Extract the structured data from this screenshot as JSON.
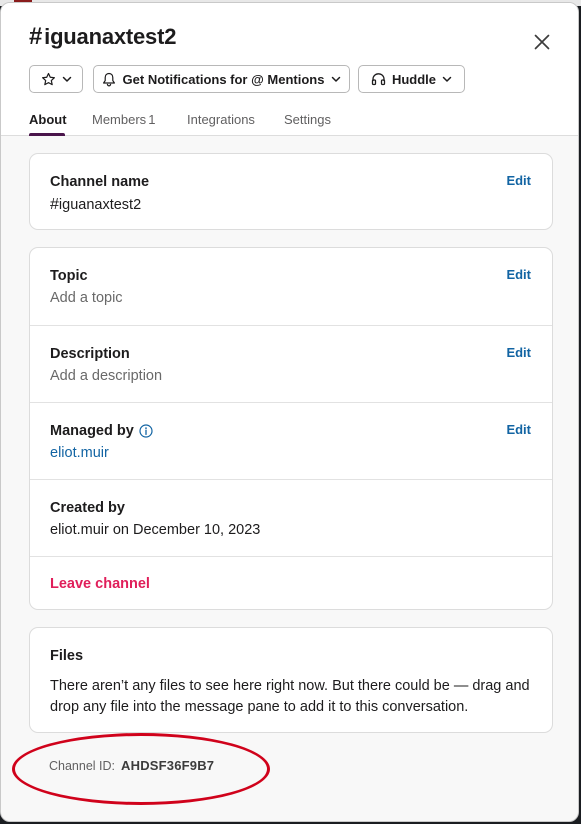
{
  "header": {
    "hash": "#",
    "channel_name": "iguanaxtest2",
    "notifications_label": "Get Notifications for @ Mentions",
    "huddle_label": "Huddle"
  },
  "tabs": [
    {
      "label": "About"
    },
    {
      "label": "Members",
      "count": "1"
    },
    {
      "label": "Integrations"
    },
    {
      "label": "Settings"
    }
  ],
  "channel_card": {
    "label": "Channel name",
    "hash": "#",
    "value": "iguanaxtest2",
    "edit": "Edit"
  },
  "details_card": {
    "topic": {
      "label": "Topic",
      "placeholder": "Add a topic",
      "edit": "Edit"
    },
    "description": {
      "label": "Description",
      "placeholder": "Add a description",
      "edit": "Edit"
    },
    "managed_by": {
      "label": "Managed by",
      "value": "eliot.muir",
      "edit": "Edit"
    },
    "created_by": {
      "label": "Created by",
      "value": "eliot.muir on December 10, 2023"
    },
    "leave": "Leave channel"
  },
  "files_card": {
    "label": "Files",
    "text": "There aren’t any files to see here right now. But there could be — drag and drop any file into the message pane to add it to this conversation."
  },
  "channel_id": {
    "label": "Channel ID:",
    "value": "AHDSF36F9B7"
  },
  "colors": {
    "accent": "#4a154b",
    "link": "#1264a3",
    "danger": "#e01e5a",
    "annotation": "#d0021b"
  }
}
